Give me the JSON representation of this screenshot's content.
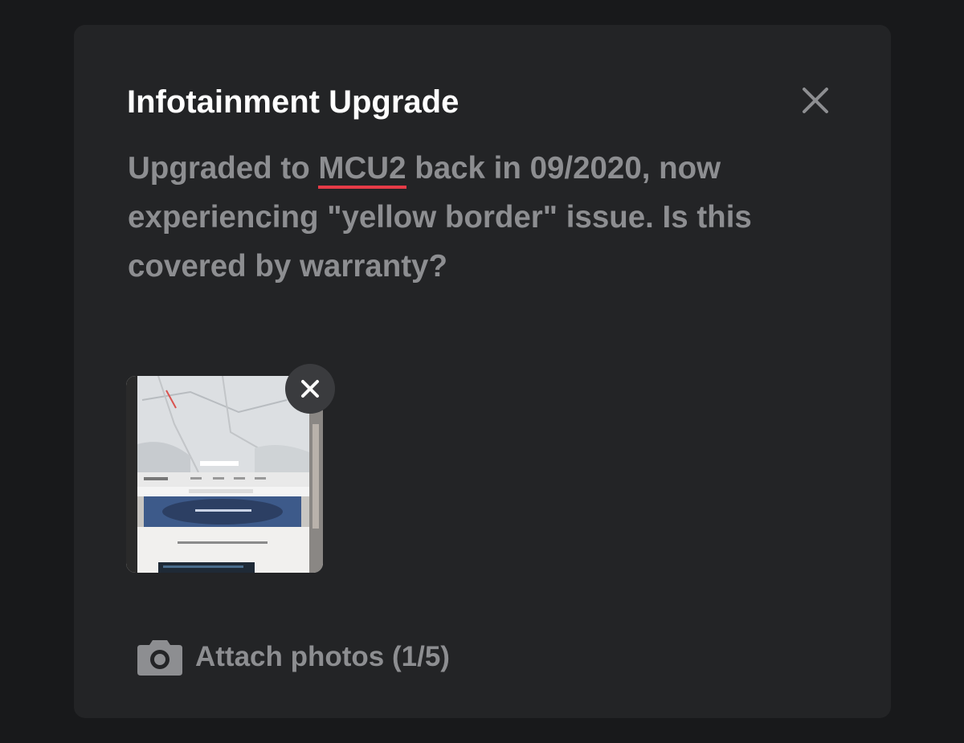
{
  "dialog": {
    "title": "Infotainment Upgrade",
    "close_icon": "close-icon"
  },
  "message": {
    "before": "Upgraded to ",
    "highlighted_word": "MCU2",
    "after": " back in 09/2020, now experiencing \"yellow border\" issue. Is this covered by warranty?"
  },
  "attachment": {
    "thumbnail_alt": "Photo of vehicle touchscreen",
    "remove_icon": "close-icon"
  },
  "attach_button": {
    "icon": "camera-icon",
    "label": "Attach photos (1/5)"
  },
  "colors": {
    "background": "#18191b",
    "card": "#232426",
    "title": "#ffffff",
    "body_text": "#8d8e91",
    "spellcheck_underline": "#e63b47"
  }
}
